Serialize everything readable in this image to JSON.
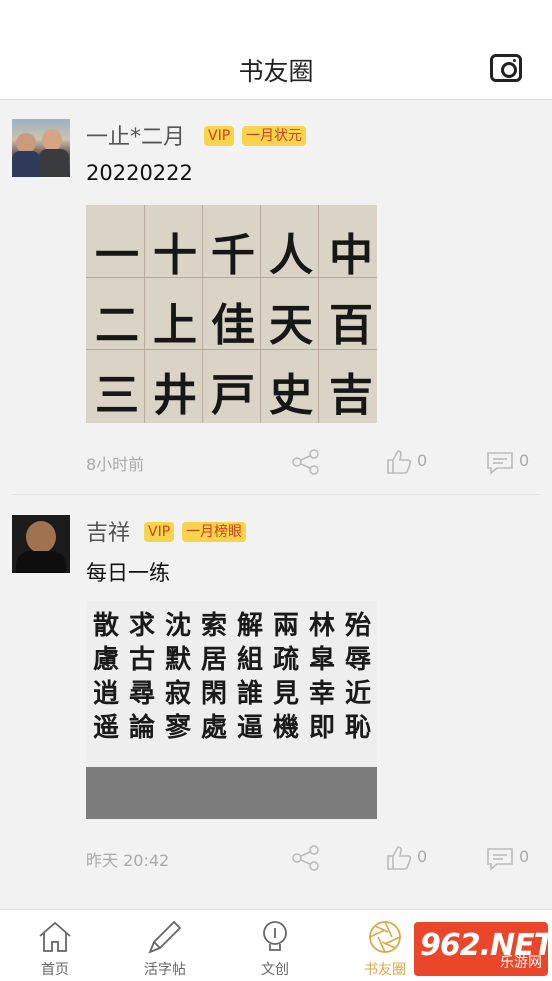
{
  "header": {
    "title": "书友圈",
    "camera_icon": "camera-icon"
  },
  "posts": [
    {
      "username": "一止*二月",
      "vip_label": "VIP",
      "rank_label": "一月状元",
      "text": "20220222",
      "photo_description_chars": [
        [
          "一",
          "十",
          "千",
          "人",
          "中"
        ],
        [
          "二",
          "上",
          "佳",
          "天",
          "百"
        ],
        [
          "三",
          "井",
          "戸",
          "史",
          "吉"
        ]
      ],
      "time": "8小时前",
      "likes": "0",
      "comments": "0"
    },
    {
      "username": "吉祥",
      "vip_label": "VIP",
      "rank_label": "一月榜眼",
      "text": "每日一练",
      "photo_columns": [
        "散慮逍遥",
        "求古尋論",
        "沈默寂寥",
        "索居閑處",
        "解組誰逼",
        "兩疏見機",
        "林皐幸即",
        "殆辱近恥"
      ],
      "time": "昨天  20:42",
      "likes": "0",
      "comments": "0"
    }
  ],
  "tabs": [
    {
      "label": "首页",
      "icon": "home-icon"
    },
    {
      "label": "活字帖",
      "icon": "brush-icon"
    },
    {
      "label": "文创",
      "icon": "bulb-icon"
    },
    {
      "label": "书友圈",
      "icon": "aperture-icon",
      "active": true
    },
    {
      "label": "",
      "icon": "user-icon"
    }
  ],
  "watermark": {
    "big": "962.NET",
    "small": "乐游网"
  },
  "colors": {
    "badge_bg": "#f6d44c",
    "badge_text": "#d2401f",
    "active_tab": "#d8a84a"
  }
}
